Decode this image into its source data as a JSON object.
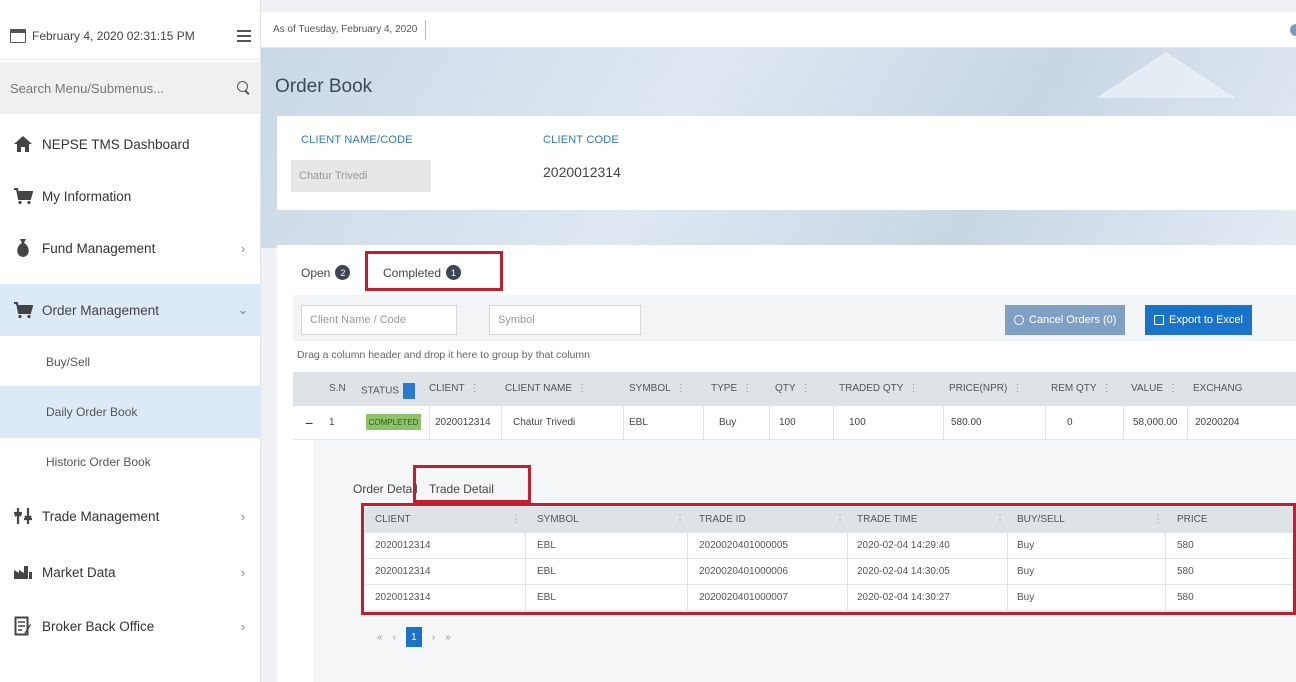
{
  "sidebar": {
    "datetime": "February 4, 2020 02:31:15 PM",
    "search_placeholder": "Search Menu/Submenus...",
    "items": [
      {
        "label": "NEPSE TMS Dashboard"
      },
      {
        "label": "My Information"
      },
      {
        "label": "Fund Management",
        "chevron": "›"
      },
      {
        "label": "Order Management",
        "chevron": "⌄"
      },
      {
        "label": "Trade Management",
        "chevron": "›"
      },
      {
        "label": "Market Data",
        "chevron": "›"
      },
      {
        "label": "Broker Back Office",
        "chevron": "›"
      }
    ],
    "subitems": [
      {
        "label": "Buy/Sell"
      },
      {
        "label": "Daily Order Book"
      },
      {
        "label": "Historic Order Book"
      }
    ]
  },
  "topbar": {
    "as_of": "As of Tuesday, February 4, 2020"
  },
  "page": {
    "title": "Order Book"
  },
  "client": {
    "name_label": "CLIENT NAME/CODE",
    "name_value": "Chatur Trivedi",
    "code_label": "CLIENT CODE",
    "code_value": "2020012314"
  },
  "tabs": {
    "open_label": "Open",
    "open_count": "2",
    "completed_label": "Completed",
    "completed_count": "1"
  },
  "filters": {
    "client_placeholder": "Client Name / Code",
    "symbol_placeholder": "Symbol",
    "cancel_label": "Cancel Orders (0)",
    "export_label": "Export to Excel"
  },
  "group_hint": "Drag a column header and drop it here to group by that column",
  "order_grid": {
    "columns": [
      "S.N",
      "STATUS",
      "CLIENT",
      "CLIENT NAME",
      "SYMBOL",
      "TYPE",
      "QTY",
      "TRADED QTY",
      "PRICE(NPR)",
      "REM QTY",
      "VALUE",
      "EXCHANG"
    ],
    "row": {
      "sn": "1",
      "status": "COMPLETED",
      "client": "2020012314",
      "client_name": "Chatur Trivedi",
      "symbol": "EBL",
      "type": "Buy",
      "qty": "100",
      "traded_qty": "100",
      "price": "580.00",
      "rem_qty": "0",
      "value": "58,000.00",
      "exchange": "20200204"
    }
  },
  "detail": {
    "order_tab": "Order Detail",
    "trade_tab": "Trade Detail",
    "columns": [
      "CLIENT",
      "SYMBOL",
      "TRADE ID",
      "TRADE TIME",
      "BUY/SELL",
      "PRICE"
    ],
    "rows": [
      [
        "2020012314",
        "EBL",
        "2020020401000005",
        "2020-02-04 14:29:40",
        "Buy",
        "580"
      ],
      [
        "2020012314",
        "EBL",
        "2020020401000006",
        "2020-02-04 14:30:05",
        "Buy",
        "580"
      ],
      [
        "2020012314",
        "EBL",
        "2020020401000007",
        "2020-02-04 14:30:27",
        "Buy",
        "580"
      ]
    ]
  },
  "pager": {
    "current": "1"
  },
  "colors": {
    "accent": "#1a73c8",
    "highlight": "#c21f2e",
    "active_bg": "#dce9f6",
    "status_green": "#8dc26b"
  }
}
